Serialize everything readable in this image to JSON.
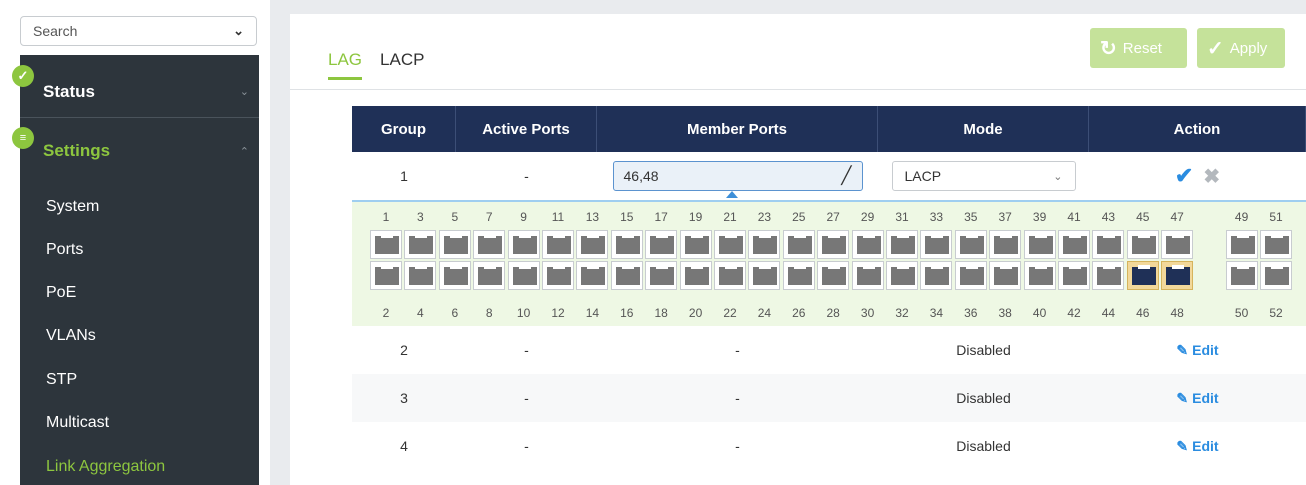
{
  "sidebar": {
    "search_value": "Search",
    "status_label": "Status",
    "settings_label": "Settings",
    "menu": [
      "System",
      "Ports",
      "PoE",
      "VLANs",
      "STP",
      "Multicast",
      "Link Aggregation"
    ]
  },
  "tabs": [
    "LAG",
    "LACP"
  ],
  "toolbar": {
    "reset_label": "Reset",
    "apply_label": "Apply"
  },
  "table": {
    "headers": [
      "Group",
      "Active Ports",
      "Member Ports",
      "Mode",
      "Action"
    ],
    "edit_row": {
      "group": "1",
      "active_ports": "-",
      "member_ports": "46,48",
      "mode": "LACP"
    },
    "rows": [
      {
        "group": "2",
        "active_ports": "-",
        "member_ports": "-",
        "mode": "Disabled",
        "action": "Edit"
      },
      {
        "group": "3",
        "active_ports": "-",
        "member_ports": "-",
        "mode": "Disabled",
        "action": "Edit"
      },
      {
        "group": "4",
        "active_ports": "-",
        "member_ports": "-",
        "mode": "Disabled",
        "action": "Edit"
      }
    ]
  },
  "ports": {
    "top_labels": [
      "1",
      "3",
      "5",
      "7",
      "9",
      "11",
      "13",
      "15",
      "17",
      "19",
      "21",
      "23",
      "25",
      "27",
      "29",
      "31",
      "33",
      "35",
      "37",
      "39",
      "41",
      "43",
      "45",
      "47",
      "49",
      "51"
    ],
    "bottom_labels": [
      "2",
      "4",
      "6",
      "8",
      "10",
      "12",
      "14",
      "16",
      "18",
      "20",
      "22",
      "24",
      "26",
      "28",
      "30",
      "32",
      "34",
      "36",
      "38",
      "40",
      "42",
      "44",
      "46",
      "48",
      "50",
      "52"
    ],
    "selected": [
      "46",
      "48"
    ]
  },
  "colors": {
    "accent": "#8dc63f",
    "header": "#1f3057",
    "link": "#2a8ce0"
  }
}
